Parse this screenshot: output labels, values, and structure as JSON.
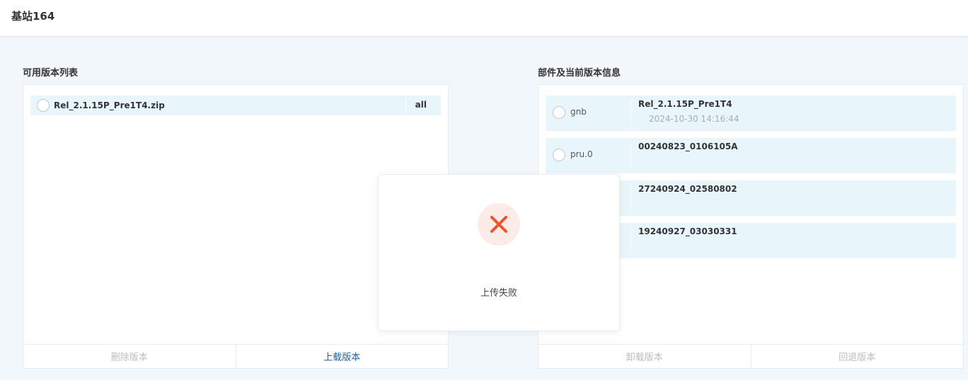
{
  "header": {
    "title": "基站164"
  },
  "left_panel": {
    "title": "可用版本列表",
    "versions": [
      {
        "name": "Rel_2.1.15P_Pre1T4.zip",
        "tag": "all"
      }
    ],
    "delete_label": "删除版本",
    "upload_label": "上载版本"
  },
  "right_panel": {
    "title": "部件及当前版本信息",
    "components": [
      {
        "name": "gnb",
        "version": "Rel_2.1.15P_Pre1T4",
        "time": "2024-10-30 14:16:44"
      },
      {
        "name": "pru.0",
        "version": "00240823_0106105A",
        "time": ""
      },
      {
        "name": "",
        "version": "27240924_02580802",
        "time": ""
      },
      {
        "name": "",
        "version": "19240927_03030331",
        "time": ""
      }
    ],
    "unload_label": "卸载版本",
    "rollback_label": "回退版本"
  },
  "dialog": {
    "icon": "error-x-icon",
    "message": "上传失败",
    "error_color": "#f0522c"
  }
}
